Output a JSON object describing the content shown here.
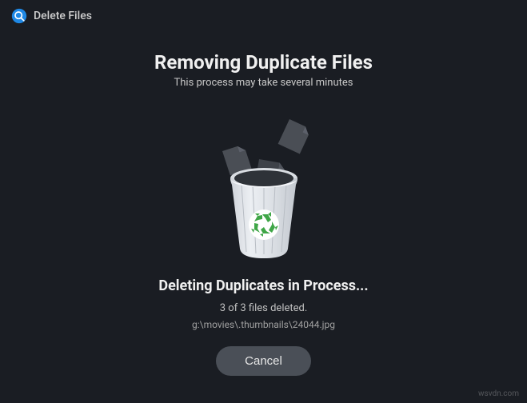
{
  "header": {
    "title": "Delete Files",
    "icon": "magnifier-search-icon"
  },
  "main": {
    "title": "Removing Duplicate Files",
    "subtitle": "This process may take several minutes"
  },
  "status": {
    "title": "Deleting Duplicates in Process...",
    "count_text": "3 of 3 files deleted.",
    "current_path": "g:\\movies\\.thumbnails\\24044.jpg"
  },
  "actions": {
    "cancel_label": "Cancel"
  },
  "watermark": "wsvdn.com"
}
